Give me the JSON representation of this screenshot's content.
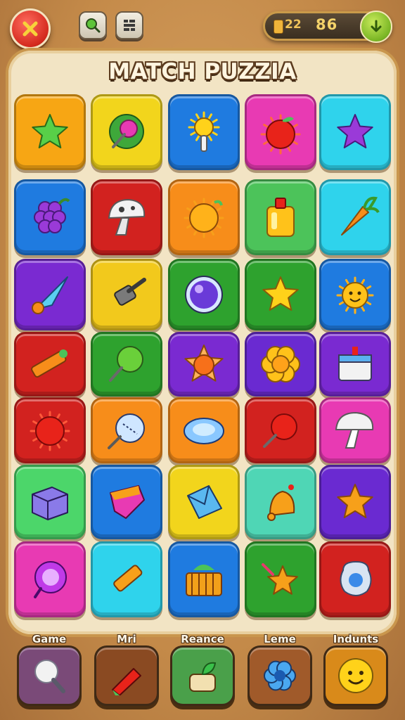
{
  "title": "MATCH PUZZIA",
  "header": {
    "level_label": "22",
    "score_value": "86"
  },
  "colors": {
    "board_bg": "#f2e4c4",
    "accent_green": "#79b524",
    "close_red": "#d42a1e"
  },
  "tiles": [
    {
      "icon": "green-star-icon",
      "bg": "#f7a614"
    },
    {
      "icon": "pink-lollipop-icon",
      "bg": "#f2d51c"
    },
    {
      "icon": "sun-wand-icon",
      "bg": "#1f7be0"
    },
    {
      "icon": "red-apple-icon",
      "bg": "#e83ab3"
    },
    {
      "icon": "purple-star-icon",
      "bg": "#2fd3ec"
    },
    {
      "icon": "grapes-icon",
      "bg": "#1f7be0"
    },
    {
      "icon": "mushroom-icon",
      "bg": "#d2221f"
    },
    {
      "icon": "orange-sun-icon",
      "bg": "#f78d1a"
    },
    {
      "icon": "potion-bottle-icon",
      "bg": "#4cc35a"
    },
    {
      "icon": "carrot-icon",
      "bg": "#2fd3ec"
    },
    {
      "icon": "cone-icon",
      "bg": "#7a2ad1"
    },
    {
      "icon": "hammer-icon",
      "bg": "#f2c91c"
    },
    {
      "icon": "purple-orb-icon",
      "bg": "#2ea22e"
    },
    {
      "icon": "yellow-star-icon",
      "bg": "#2ea22e"
    },
    {
      "icon": "smiling-sun-icon",
      "bg": "#1f7be0"
    },
    {
      "icon": "crayon-icon",
      "bg": "#d2221f"
    },
    {
      "icon": "green-pin-icon",
      "bg": "#2ea22e"
    },
    {
      "icon": "orange-gem-icon",
      "bg": "#7a2ad1"
    },
    {
      "icon": "flower-button-icon",
      "bg": "#6a2ad1"
    },
    {
      "icon": "gift-box-icon",
      "bg": "#7a2ad1"
    },
    {
      "icon": "red-sun-icon",
      "bg": "#d2221f"
    },
    {
      "icon": "blue-ball-pin-icon",
      "bg": "#f78d1a"
    },
    {
      "icon": "blue-gem-icon",
      "bg": "#f78d1a"
    },
    {
      "icon": "red-pushpin-icon",
      "bg": "#d2221f"
    },
    {
      "icon": "white-mushroom-icon",
      "bg": "#e83ab3"
    },
    {
      "icon": "purple-cube-icon",
      "bg": "#4cd66a"
    },
    {
      "icon": "magenta-box-icon",
      "bg": "#1f7be0"
    },
    {
      "icon": "envelope-icon",
      "bg": "#f2d51c"
    },
    {
      "icon": "bell-icon",
      "bg": "#4fd6b5"
    },
    {
      "icon": "orange-star-icon",
      "bg": "#6a2ad1"
    },
    {
      "icon": "ring-icon",
      "bg": "#e83ab3"
    },
    {
      "icon": "pencil-icon",
      "bg": "#2fd3ec"
    },
    {
      "icon": "basket-icon",
      "bg": "#1f7be0"
    },
    {
      "icon": "star-wand-icon",
      "bg": "#2ea22e"
    },
    {
      "icon": "blue-badge-icon",
      "bg": "#d2221f"
    }
  ],
  "bottom_nav": [
    {
      "label": "Game",
      "icon": "magnifier-icon",
      "bg": "#7a4a78"
    },
    {
      "label": "Mri",
      "icon": "crystal-icon",
      "bg": "#8a4a22"
    },
    {
      "label": "Reance",
      "icon": "leaf-pot-icon",
      "bg": "#4aa04a"
    },
    {
      "label": "Leme",
      "icon": "blue-flower-icon",
      "bg": "#a05a2a"
    },
    {
      "label": "Indunts",
      "icon": "smiley-icon",
      "bg": "#d98a1a"
    }
  ]
}
